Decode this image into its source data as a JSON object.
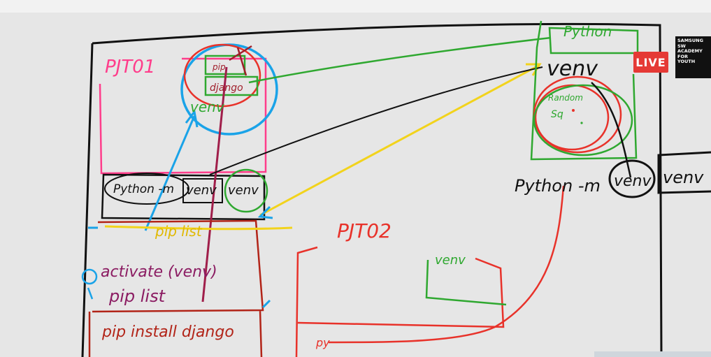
{
  "labels": {
    "pjt01": "PJT01",
    "pjt02": "PJT02",
    "pip_small": "pip",
    "django_small": "django",
    "venv_pjt01": "venv",
    "cmd_left_part1": "Python -m",
    "cmd_left_part2": "venv",
    "cmd_left_part3": "venv",
    "pip_list_yellow": "pip list",
    "activate": "activate (venv)",
    "pip_list_purple": "pip list",
    "pip_install": "pip install django",
    "python_top": "Python",
    "venv_right": "venv",
    "random_small": "Random",
    "sq_small": "Sq",
    "cmd_right_part1": "Python -m",
    "cmd_right_part2": "venv",
    "cmd_right_part3": "venv",
    "venv_pjt02": "venv",
    "py_small": "py"
  },
  "badges": {
    "live": "LIVE",
    "logo_lines": [
      "SAMSUNG",
      "SW",
      "ACADEMY",
      "FOR",
      "YOUTH"
    ]
  },
  "colors": {
    "board": "#e6e6e6",
    "black": "#111111",
    "pink": "#ff3d8b",
    "red": "#e8322a",
    "green": "#2fa830",
    "blue": "#1aa3e8",
    "yellow": "#f2d31c",
    "maroon": "#a01e2a",
    "purple": "#8b1c62",
    "dark_red": "#b22418"
  }
}
